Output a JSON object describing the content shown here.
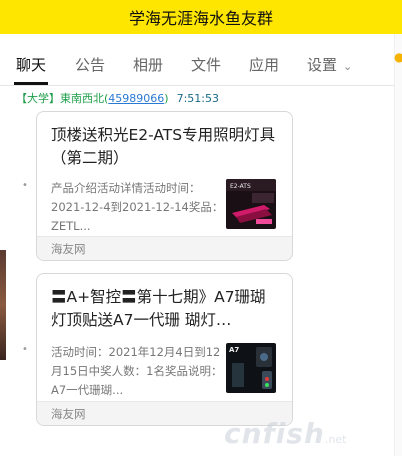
{
  "window": {
    "title": "学海无涯海水鱼友群"
  },
  "tabs": [
    {
      "label": "聊天",
      "active": true
    },
    {
      "label": "公告"
    },
    {
      "label": "相册"
    },
    {
      "label": "文件"
    },
    {
      "label": "应用"
    },
    {
      "label": "设置"
    }
  ],
  "message": {
    "tag": "【大学】",
    "name": "東南西北",
    "qq_open": "(",
    "qq": "45989066",
    "qq_close": ")",
    "time": "7:51:53"
  },
  "cards": [
    {
      "title": "顶楼送积光E2-ATS专用照明灯具（第二期）",
      "desc": "产品介绍活动详情活动时间：2021-12-4到2021-12-14奖品：ZETL...",
      "source": "海友网",
      "thumb_icon": "product-photo-icon"
    },
    {
      "title": "〓A+智控〓第十七期》A7珊瑚灯顶贴送A7一代珊 瑚灯…",
      "desc": "活动时间：2021年12月4日到12月15日中奖人数：1名奖品说明：A7一代珊瑚...",
      "source": "海友网",
      "thumb_icon": "coral-light-photo-icon"
    }
  ],
  "watermark": {
    "text": "cnfish",
    "suffix": ".net"
  },
  "colors": {
    "titlebar": "#ffe600",
    "green": "#1e9e4a",
    "link": "#2a7ad4"
  }
}
